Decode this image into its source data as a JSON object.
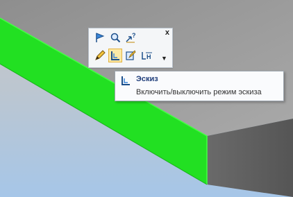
{
  "colors": {
    "background_top": "#c4c4c4",
    "background_bottom": "#a8c8ea",
    "box_top": "#9e9e9e",
    "box_front": "#22e022",
    "box_side": "#5f5f5f",
    "edge_highlight": "#2cff2c"
  },
  "toolbar": {
    "close_label": "x",
    "more_label": "▼",
    "buttons": [
      {
        "icon": "flag-icon"
      },
      {
        "icon": "zoom-icon"
      },
      {
        "icon": "help-cursor-icon"
      },
      {
        "icon": "pencil-icon"
      },
      {
        "icon": "sketch-icon",
        "active": true
      },
      {
        "icon": "edit-sketch-icon"
      },
      {
        "icon": "dimension-icon"
      }
    ]
  },
  "tooltip": {
    "title": "Эскиз",
    "description": "Включить/выключить режим эскиза"
  }
}
